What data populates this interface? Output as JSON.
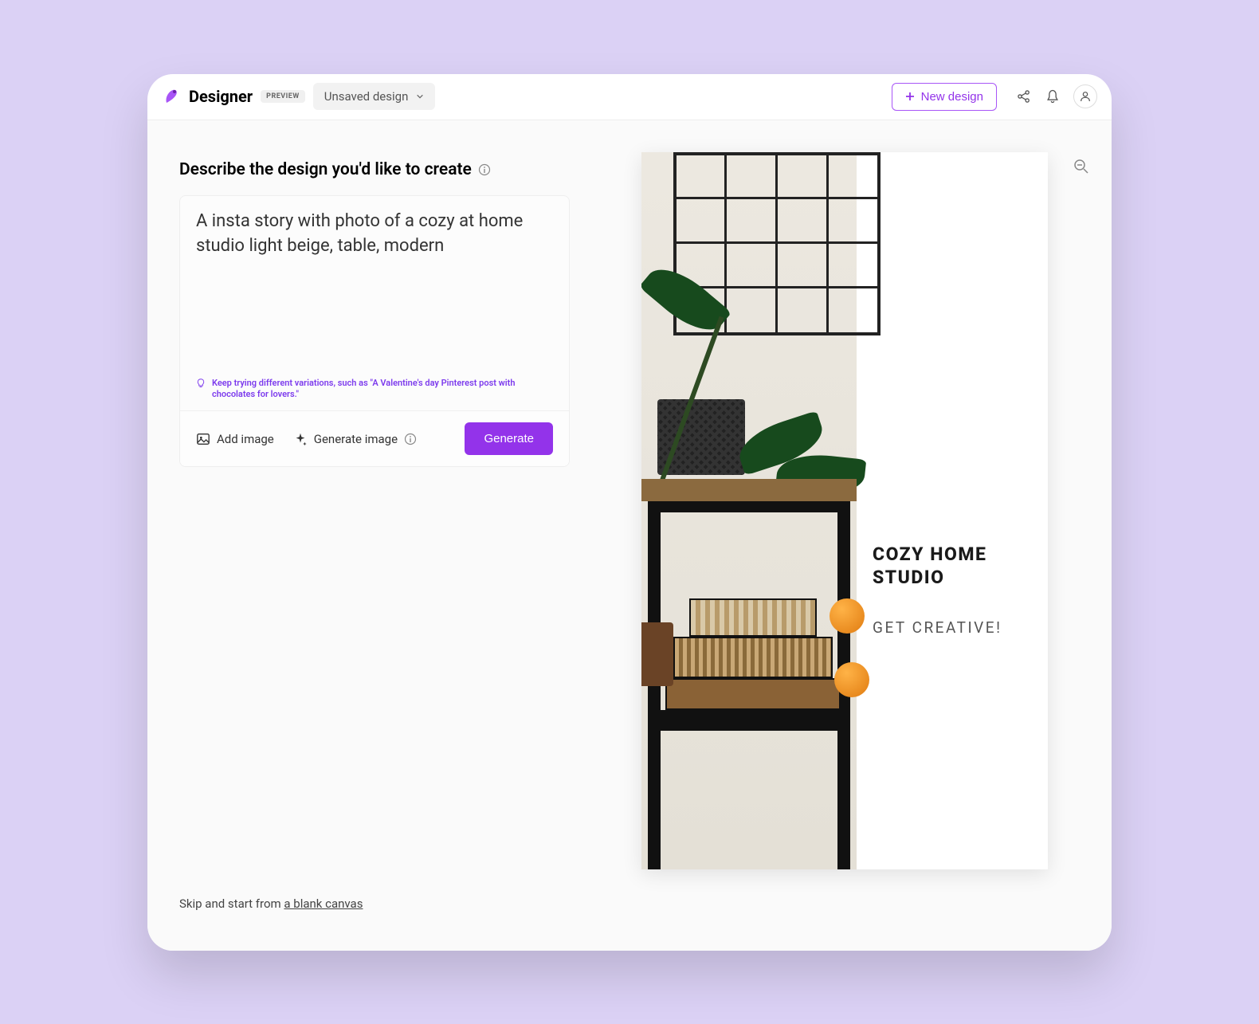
{
  "header": {
    "title": "Designer",
    "badge": "PREVIEW",
    "doc_name": "Unsaved design",
    "new_design_label": "New design"
  },
  "left": {
    "heading": "Describe the design you'd like to create",
    "prompt": "A insta story with photo of a cozy at home studio light beige, table, modern",
    "hint": "Keep trying different variations, such as \"A Valentine's day Pinterest post with chocolates for lovers.\"",
    "add_image": "Add image",
    "generate_image": "Generate image",
    "generate_btn": "Generate",
    "skip_prefix": "Skip and start from ",
    "skip_link": "a blank canvas"
  },
  "preview": {
    "title": "COZY HOME STUDIO",
    "subtitle": "GET CREATIVE!"
  }
}
